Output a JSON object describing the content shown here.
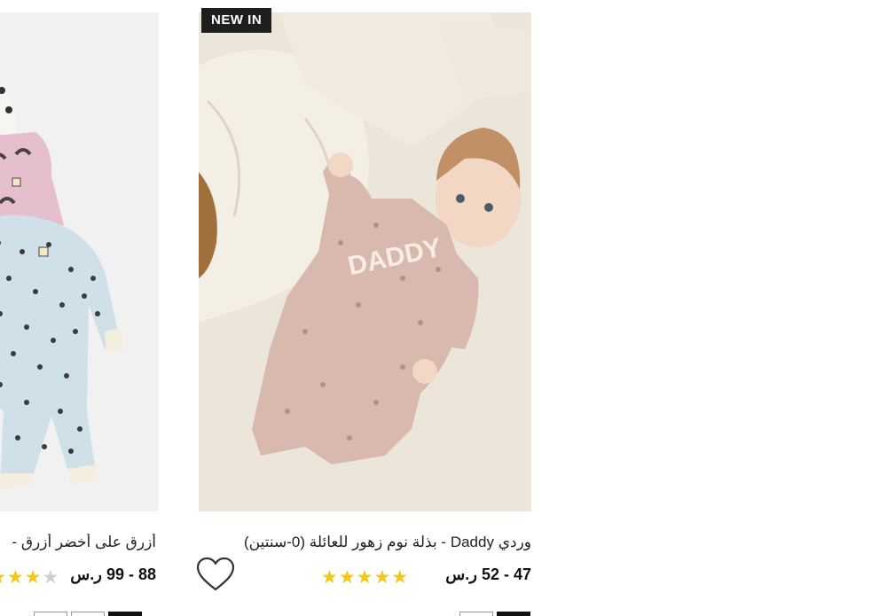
{
  "products": [
    {
      "title": "أزرق على أخضر أزرق - ",
      "price": "88 - 99 ر.س",
      "rating_stars": 3.5
    },
    {
      "badge": "NEW IN",
      "title": "وردي Daddy - بذلة نوم زهور للعائلة (0-سنتين)",
      "price": "47 - 52 ر.س",
      "rating_stars": 5
    }
  ],
  "icons": {
    "wishlist": "heart-outline-icon",
    "rating": "star-icon"
  },
  "colors": {
    "star": "#f5c518",
    "badge_bg": "#1e1e1e"
  }
}
